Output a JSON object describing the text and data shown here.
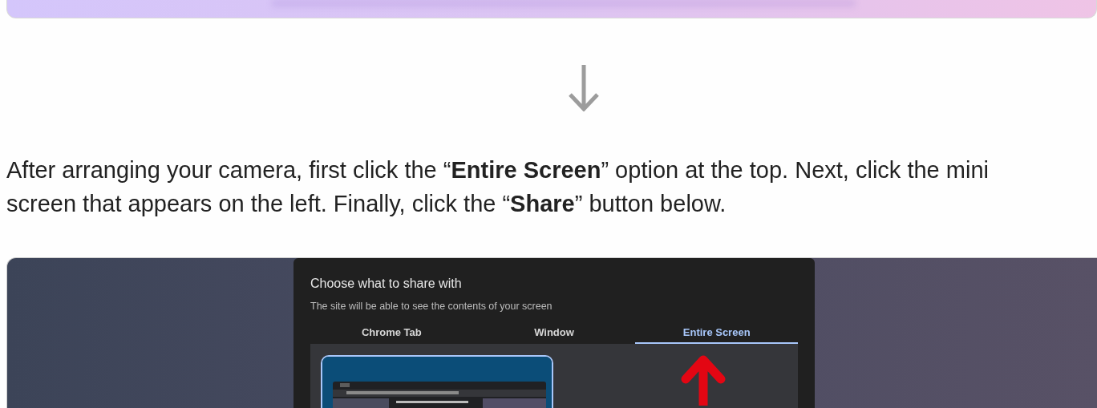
{
  "instruction": "After arranging your camera, first click the “**Entire Screen**” option at the top. Next, click the mini screen that appears on the left. Finally, click the “**Share**” button below.",
  "dialog": {
    "title": "Choose what to share with",
    "subtitle": "The site will be able to see the contents of your screen",
    "tabs": [
      {
        "label": "Chrome Tab",
        "selected": false
      },
      {
        "label": "Window",
        "selected": false
      },
      {
        "label": "Entire Screen",
        "selected": true
      }
    ],
    "screens": [
      {
        "kind": "picture",
        "selected": true
      }
    ]
  }
}
